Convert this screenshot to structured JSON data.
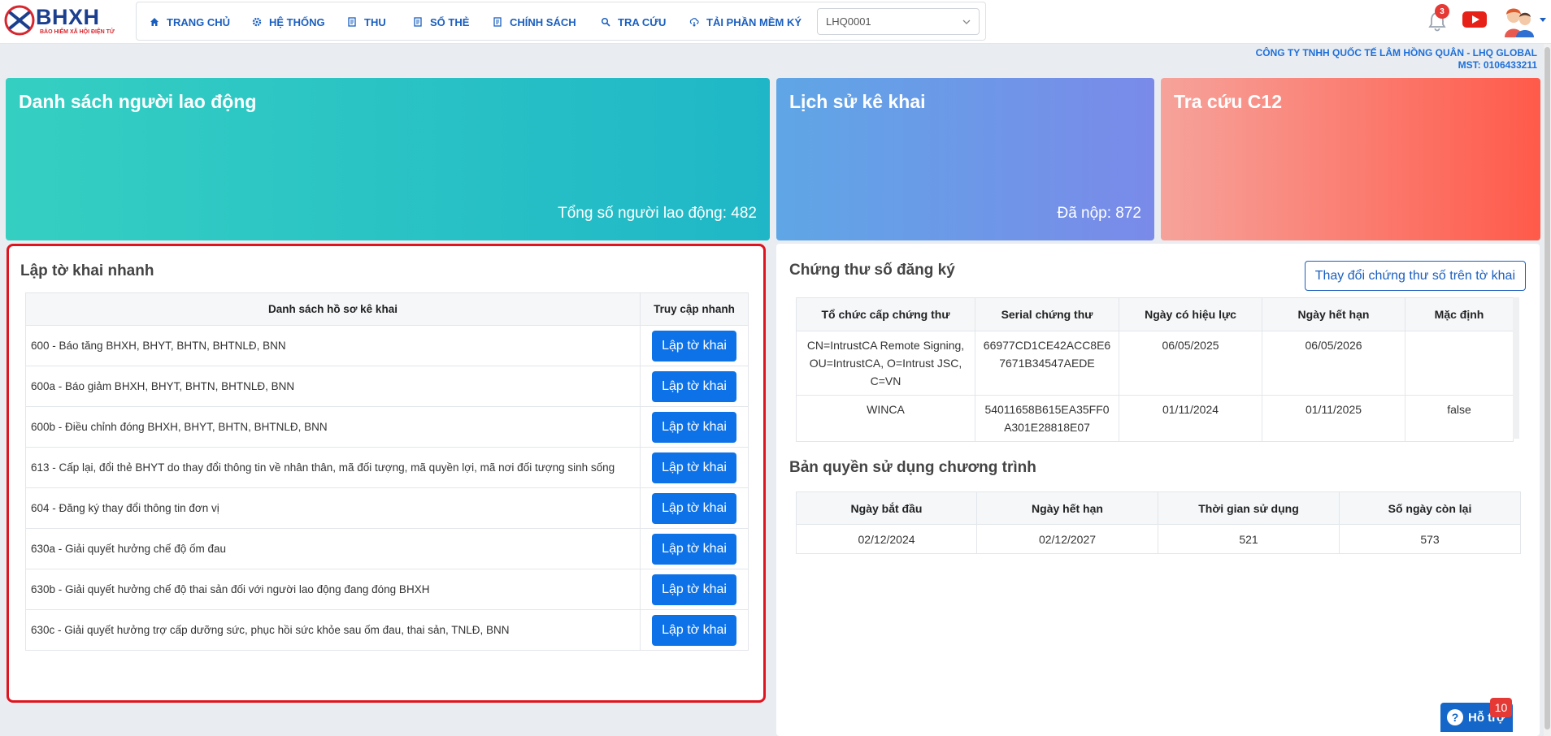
{
  "brand": {
    "logo_text": "BHXH",
    "logo_subtitle": "BẢO HIỂM XÃ HỘI ĐIỆN TỬ",
    "accent": "#1a5fbf",
    "logo_red": "#d7262e"
  },
  "nav": {
    "items": [
      {
        "label": "TRANG CHỦ",
        "icon": "home-icon"
      },
      {
        "label": "HỆ THỐNG",
        "icon": "gear-icon"
      },
      {
        "label": "THU",
        "icon": "document-icon"
      },
      {
        "label": "SỔ THẺ",
        "icon": "card-icon"
      },
      {
        "label": "CHÍNH SÁCH",
        "icon": "policy-icon"
      },
      {
        "label": "TRA CỨU",
        "icon": "search-icon"
      },
      {
        "label": "TẢI PHẦN MỀM KÝ",
        "icon": "cloud-download-icon"
      }
    ],
    "unit_select_value": "LHQ0001"
  },
  "header_right": {
    "notification_count": "3"
  },
  "company": {
    "name": "CÔNG TY TNHH QUỐC TẾ LÂM HỒNG QUÂN - LHQ GLOBAL",
    "tax_code": "MST: 0106433211"
  },
  "cards": [
    {
      "title": "Danh sách người lao động",
      "stat": "Tổng số người lao động: 482",
      "color_from": "#35cfc2",
      "color_to": "#1fb7c7"
    },
    {
      "title": "Lịch sử kê khai",
      "stat": "Đã nộp: 872",
      "color_from": "#5fa6e6",
      "color_to": "#7a8ae9"
    },
    {
      "title": "Tra cứu C12",
      "stat": "",
      "color_from": "#f6a39b",
      "color_to": "#ff5a4a"
    }
  ],
  "quick_form": {
    "title": "Lập tờ khai nhanh",
    "columns": [
      "Danh sách hồ sơ kê khai",
      "Truy cập nhanh"
    ],
    "button_label": "Lập tờ khai",
    "rows": [
      "600 - Báo tăng BHXH, BHYT, BHTN, BHTNLĐ, BNN",
      "600a - Báo giảm BHXH, BHYT, BHTN, BHTNLĐ, BNN",
      "600b - Điều chỉnh đóng BHXH, BHYT, BHTN, BHTNLĐ, BNN",
      "613 - Cấp lại, đổi thẻ BHYT do thay đổi thông tin về nhân thân, mã đối tượng, mã quyền lợi, mã nơi đối tượng sinh sống",
      "604 - Đăng ký thay đổi thông tin đơn vị",
      "630a - Giải quyết hưởng chế độ ốm đau",
      "630b - Giải quyết hưởng chế độ thai sản đối với người lao động đang đóng BHXH",
      "630c - Giải quyết hưởng trợ cấp dưỡng sức, phục hồi sức khỏe sau ốm đau, thai sản, TNLĐ, BNN"
    ]
  },
  "certificates": {
    "title": "Chứng thư số đăng ký",
    "change_button": "Thay đổi chứng thư số trên tờ khai",
    "columns": [
      "Tổ chức cấp chứng thư",
      "Serial chứng thư",
      "Ngày có hiệu lực",
      "Ngày hết hạn",
      "Mặc định"
    ],
    "rows": [
      [
        "CN=IntrustCA Remote Signing, OU=IntrustCA, O=Intrust JSC, C=VN",
        "66977CD1CE42ACC8E67671B34547AEDE",
        "06/05/2025",
        "06/05/2026",
        ""
      ],
      [
        "WINCA",
        "54011658B615EA35FF0A301E28818E07",
        "01/11/2024",
        "01/11/2025",
        "false"
      ]
    ]
  },
  "license": {
    "title": "Bản quyền sử dụng chương trình",
    "columns": [
      "Ngày bắt đầu",
      "Ngày hết hạn",
      "Thời gian sử dụng",
      "Số ngày còn lại"
    ],
    "row": [
      "02/12/2024",
      "02/12/2027",
      "521",
      "573"
    ]
  },
  "support": {
    "label": "Hỗ trợ",
    "badge": "10"
  }
}
